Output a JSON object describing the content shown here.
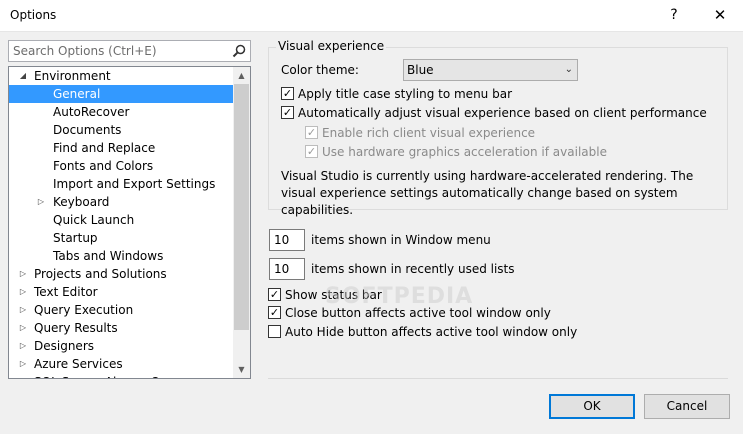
{
  "window": {
    "title": "Options",
    "help_label": "?",
    "close_label": "✕"
  },
  "search": {
    "placeholder": "Search Options (Ctrl+E)"
  },
  "tree": {
    "items": [
      {
        "label": "Environment",
        "indent": 0,
        "expander": "expanded"
      },
      {
        "label": "General",
        "indent": 1,
        "expander": "none",
        "selected": true
      },
      {
        "label": "AutoRecover",
        "indent": 1,
        "expander": "none"
      },
      {
        "label": "Documents",
        "indent": 1,
        "expander": "none"
      },
      {
        "label": "Find and Replace",
        "indent": 1,
        "expander": "none"
      },
      {
        "label": "Fonts and Colors",
        "indent": 1,
        "expander": "none"
      },
      {
        "label": "Import and Export Settings",
        "indent": 1,
        "expander": "none"
      },
      {
        "label": "Keyboard",
        "indent": 1,
        "expander": "collapsed"
      },
      {
        "label": "Quick Launch",
        "indent": 1,
        "expander": "none"
      },
      {
        "label": "Startup",
        "indent": 1,
        "expander": "none"
      },
      {
        "label": "Tabs and Windows",
        "indent": 1,
        "expander": "none"
      },
      {
        "label": "Projects and Solutions",
        "indent": 0,
        "expander": "collapsed"
      },
      {
        "label": "Text Editor",
        "indent": 0,
        "expander": "collapsed"
      },
      {
        "label": "Query Execution",
        "indent": 0,
        "expander": "collapsed"
      },
      {
        "label": "Query Results",
        "indent": 0,
        "expander": "collapsed"
      },
      {
        "label": "Designers",
        "indent": 0,
        "expander": "collapsed"
      },
      {
        "label": "Azure Services",
        "indent": 0,
        "expander": "collapsed"
      },
      {
        "label": "SQL Server Always On",
        "indent": 0,
        "expander": "collapsed"
      }
    ]
  },
  "visual": {
    "group_title": "Visual experience",
    "color_theme_label": "Color theme:",
    "color_theme_value": "Blue",
    "apply_title_case": "Apply title case styling to menu bar",
    "auto_adjust": "Automatically adjust visual experience based on client performance",
    "rich_client": "Enable rich client visual experience",
    "hw_accel": "Use hardware graphics acceleration if available",
    "description": "Visual Studio is currently using hardware-accelerated rendering. The visual experience settings automatically change based on system capabilities."
  },
  "window_menu": {
    "value": "10",
    "label": "items shown in Window menu"
  },
  "recent_lists": {
    "value": "10",
    "label": "items shown in recently used lists"
  },
  "options": {
    "show_status_bar": "Show status bar",
    "close_button": "Close button affects active tool window only",
    "auto_hide": "Auto Hide button affects active tool window only"
  },
  "buttons": {
    "ok": "OK",
    "cancel": "Cancel"
  },
  "watermark": "SOFTPEDIA",
  "colors": {
    "selection": "#3399ff",
    "accent_border": "#0078d7"
  }
}
